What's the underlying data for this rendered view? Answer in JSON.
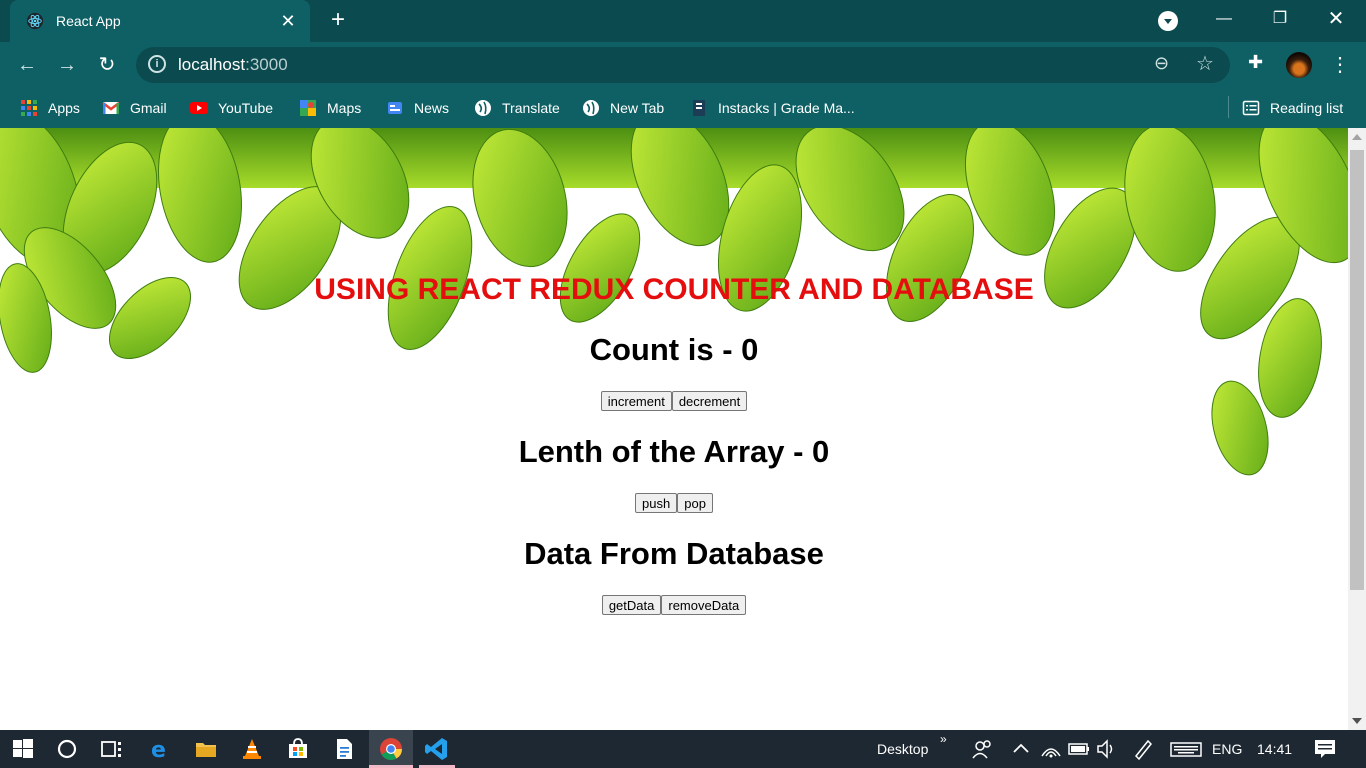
{
  "browser": {
    "tab_title": "React App",
    "url_host": "localhost",
    "url_port": ":3000",
    "bookmarks": [
      "Apps",
      "Gmail",
      "YouTube",
      "Maps",
      "News",
      "Translate",
      "New Tab",
      "Instacks | Grade Ma..."
    ],
    "reading_list": "Reading list"
  },
  "page": {
    "title": "USING REACT REDUX COUNTER AND DATABASE",
    "count_heading": "Count is - 0",
    "count_buttons": [
      "increment",
      "decrement"
    ],
    "array_heading": "Lenth of the Array - 0",
    "array_buttons": [
      "push",
      "pop"
    ],
    "db_heading": "Data From Database",
    "db_buttons": [
      "getData",
      "removeData"
    ]
  },
  "taskbar": {
    "desktop_label": "Desktop",
    "language": "ENG",
    "time": "14:41"
  },
  "colors": {
    "title_red": "#e50e0e",
    "chrome_teal": "#0e6064",
    "leaf_green": "#8ed11c"
  }
}
